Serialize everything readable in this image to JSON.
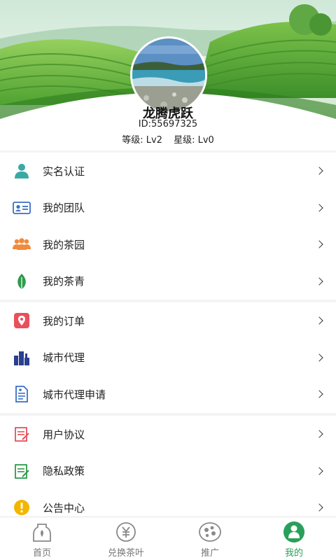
{
  "profile": {
    "username": "龙腾虎跃",
    "id_text": "ID:55697325",
    "level_text": "等级: Lv2",
    "star_text": "星级: Lv0"
  },
  "menu_group_1": [
    {
      "label": "实名认证",
      "icon": "person-icon"
    },
    {
      "label": "我的团队",
      "icon": "id-card-icon"
    },
    {
      "label": "我的茶园",
      "icon": "group-icon"
    },
    {
      "label": "我的茶青",
      "icon": "leaf-icon"
    }
  ],
  "menu_group_2": [
    {
      "label": "我的订单",
      "icon": "location-pin-icon"
    },
    {
      "label": "城市代理",
      "icon": "buildings-icon"
    },
    {
      "label": "城市代理申请",
      "icon": "document-icon"
    }
  ],
  "menu_group_3": [
    {
      "label": "用户协议",
      "icon": "agreement-icon"
    },
    {
      "label": "隐私政策",
      "icon": "policy-icon"
    },
    {
      "label": "公告中心",
      "icon": "notice-icon"
    }
  ],
  "tabbar": [
    {
      "label": "首页",
      "icon": "home-jar-icon",
      "active": false
    },
    {
      "label": "兑换茶叶",
      "icon": "yuan-coin-icon",
      "active": false
    },
    {
      "label": "推广",
      "icon": "share-dots-icon",
      "active": false
    },
    {
      "label": "我的",
      "icon": "user-icon",
      "active": true
    }
  ],
  "colors": {
    "accent": "#2a9f5b",
    "icon_teal": "#3aa9a4",
    "icon_blue": "#3a6fc4",
    "icon_orange": "#f08a3c",
    "icon_green": "#2e9b4b",
    "icon_red": "#e8505b",
    "icon_navy": "#2b3f8f",
    "icon_yellow": "#f2b600"
  }
}
